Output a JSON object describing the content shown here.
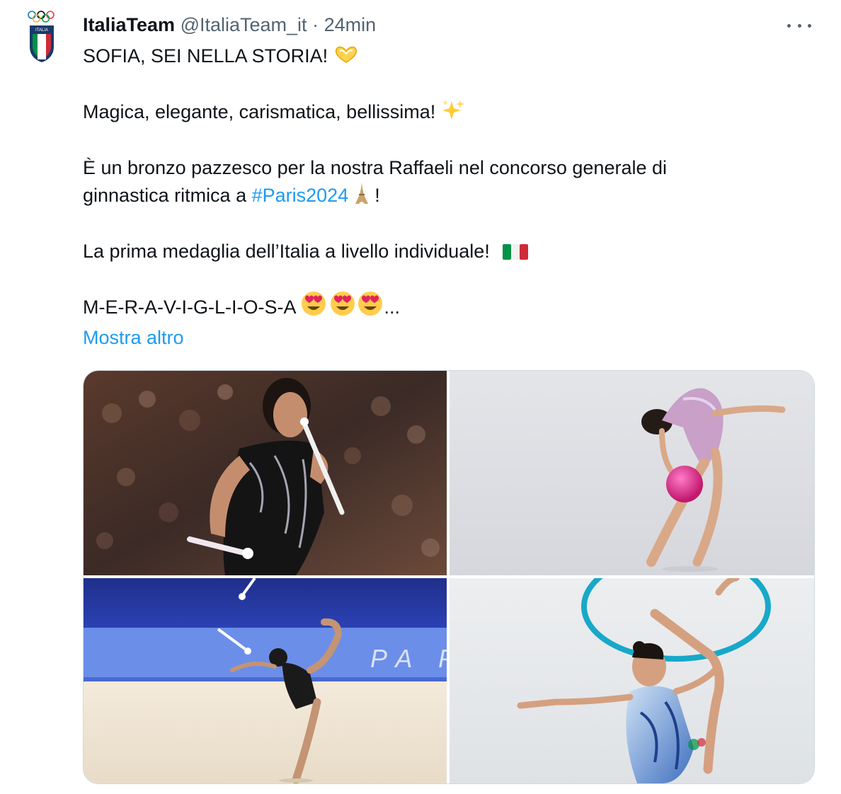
{
  "tweet": {
    "author_name": "ItaliaTeam",
    "author_handle": "@ItaliaTeam_it",
    "separator": " · ",
    "time": "24min",
    "line1": "SOFIA, SEI NELLA STORIA!",
    "line2": "Magica, elegante, carismatica, bellissima!",
    "line3a": "È un bronzo pazzesco per la nostra Raffaeli nel concorso generale di",
    "line3b": "ginnastica ritmica a ",
    "hashtag": "#Paris2024",
    "line3c": " !",
    "line4": "La prima medaglia dell’Italia a livello individuale!",
    "line5": "M-E-R-A-V-I-G-L-I-O-S-A",
    "ellipsis": "...",
    "show_more": "Mostra altro"
  },
  "avatar": {
    "logo_text": "ITALIA"
  },
  "media": {
    "photos": [
      {
        "name": "photo-gymnast-clubs"
      },
      {
        "name": "photo-gymnast-ball"
      },
      {
        "name": "photo-gymnast-arena"
      },
      {
        "name": "photo-gymnast-hoop"
      }
    ],
    "arena_letters": "PA P"
  },
  "colors": {
    "text": "#0f1419",
    "secondary": "#536471",
    "link": "#1d9bf0",
    "border": "#cfd9de"
  },
  "icons": [
    "olympic-rings-icon",
    "heart-hands-emoji",
    "sparkles-emoji",
    "eiffel-tower-emoji",
    "italy-flag-emoji",
    "heart-eyes-emoji",
    "more-options-icon"
  ]
}
